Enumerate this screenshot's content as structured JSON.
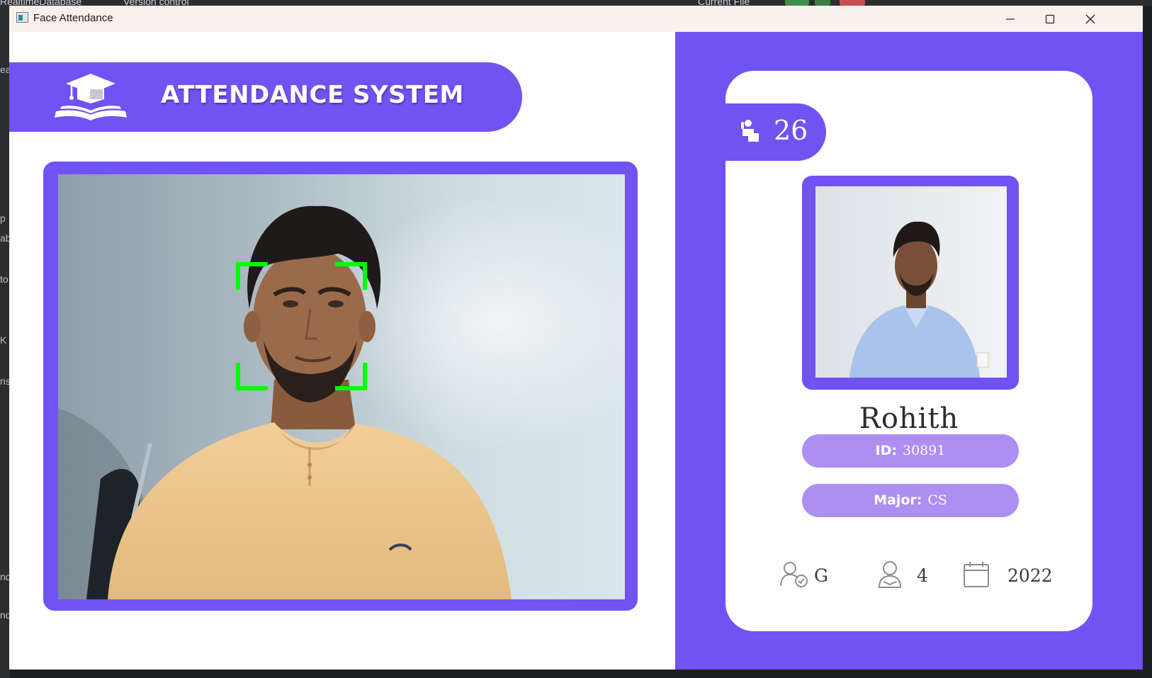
{
  "ide": {
    "project_label": "RealtimeDatabase",
    "vcs_label": "Version control",
    "run_config_label": "Current File",
    "left_fragments": [
      "ea",
      "p",
      "ab",
      "to",
      "K",
      "ns",
      "nd",
      "nd"
    ]
  },
  "window": {
    "title": "Face Attendance",
    "minimize_icon": "minimize-icon",
    "maximize_icon": "maximize-icon",
    "close_icon": "close-icon"
  },
  "banner": {
    "title": "ATTENDANCE SYSTEM",
    "logo_icon": "graduation-cap-book-icon"
  },
  "student": {
    "total_attendance": "26",
    "name": "Rohith",
    "id_label": "ID:",
    "id_value": "30891",
    "major_label": "Major:",
    "major_value": "CS",
    "standing": "G",
    "year": "4",
    "starting_year": "2022"
  },
  "colors": {
    "primary": "#7152f3",
    "pill": "#ad8ff2",
    "face_box": "#00ff00",
    "card": "#ffffff"
  }
}
